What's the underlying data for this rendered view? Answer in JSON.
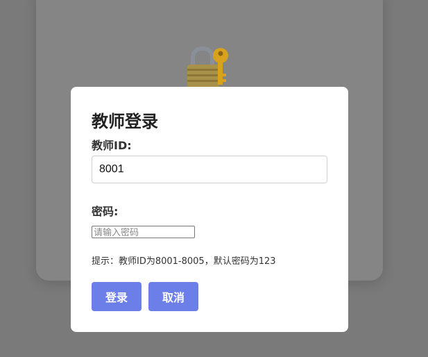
{
  "background": {
    "icon": "lock-with-key-icon"
  },
  "modal": {
    "title": "教师登录",
    "teacher_id_label": "教师ID:",
    "teacher_id_value": "8001",
    "password_label": "密码:",
    "password_placeholder": "请输入密码",
    "hint": "提示：教师ID为8001-8005，默认密码为123",
    "login_button": "登录",
    "cancel_button": "取消"
  },
  "colors": {
    "overlay": "#7a7a7a",
    "accent": "#6c7ee8",
    "modal_bg": "#ffffff"
  }
}
